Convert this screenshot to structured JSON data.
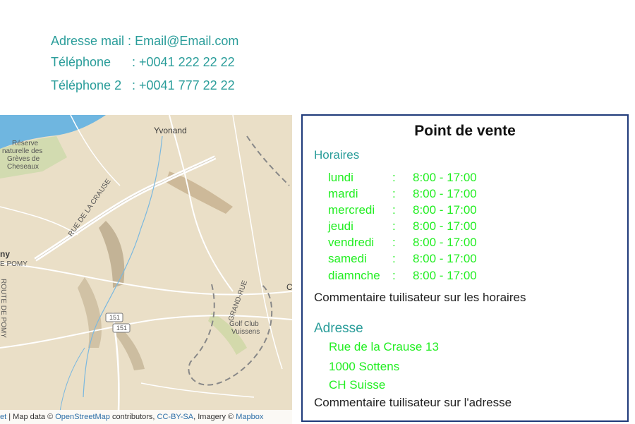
{
  "contact": {
    "email_label": "Adresse mail :",
    "email_value": "Email@Email.com",
    "phone_label": "Téléphone",
    "phone_value": ": +0041 222 22 22",
    "phone2_label": "Téléphone 2",
    "phone2_value": ": +0041 777 22 22"
  },
  "map": {
    "labels": {
      "yvonand": "Yvonand",
      "reserve1": "Réserve",
      "reserve2": "naturelle des",
      "reserve3": "Grèves de",
      "reserve4": "Cheseaux",
      "rue_crause": "RUE DE LA CRAUSE",
      "pomy_left": "ny",
      "route_pomy": "E POMY",
      "route_pomy2": "ROUTE DE POMY",
      "grand_rue": "GRAND-RUE",
      "golf1": "Golf Club",
      "golf2": "Vuissens",
      "road_151a": "151",
      "road_151b": "151",
      "edge_c": "C"
    },
    "attribution": {
      "prefix": "et",
      "text1": " | Map data © ",
      "osm": "OpenStreetMap",
      "text2": " contributors, ",
      "license": "CC-BY-SA",
      "text3": ", Imagery © ",
      "mapbox": "Mapbox"
    }
  },
  "panel": {
    "title": "Point de vente",
    "hours_title": "Horaires",
    "hours": [
      {
        "day": "lundi",
        "sep": ":",
        "time": "8:00 - 17:00"
      },
      {
        "day": "mardi",
        "sep": ":",
        "time": "8:00 - 17:00"
      },
      {
        "day": "mercredi",
        "sep": ":",
        "time": "8:00 - 17:00"
      },
      {
        "day": "jeudi",
        "sep": ":",
        "time": "8:00 - 17:00"
      },
      {
        "day": "vendredi",
        "sep": ":",
        "time": "8:00 - 17:00"
      },
      {
        "day": "samedi",
        "sep": ":",
        "time": "8:00 - 17:00"
      },
      {
        "day": "diamnche",
        "sep": ":",
        "time": "8:00 - 17:00"
      }
    ],
    "hours_comment": "Commentaire tuilisateur sur les horaires",
    "address_title": "Adresse",
    "address_lines": [
      "Rue de la Crause 13",
      "1000 Sottens",
      "CH Suisse"
    ],
    "address_comment": "Commentaire tuilisateur sur l'adresse"
  },
  "colors": {
    "teal": "#2a9d9a",
    "green_text": "#22ee22",
    "panel_border": "#1f3a7a",
    "lake": "#6fb6e0",
    "map_land": "#eadfc7"
  }
}
